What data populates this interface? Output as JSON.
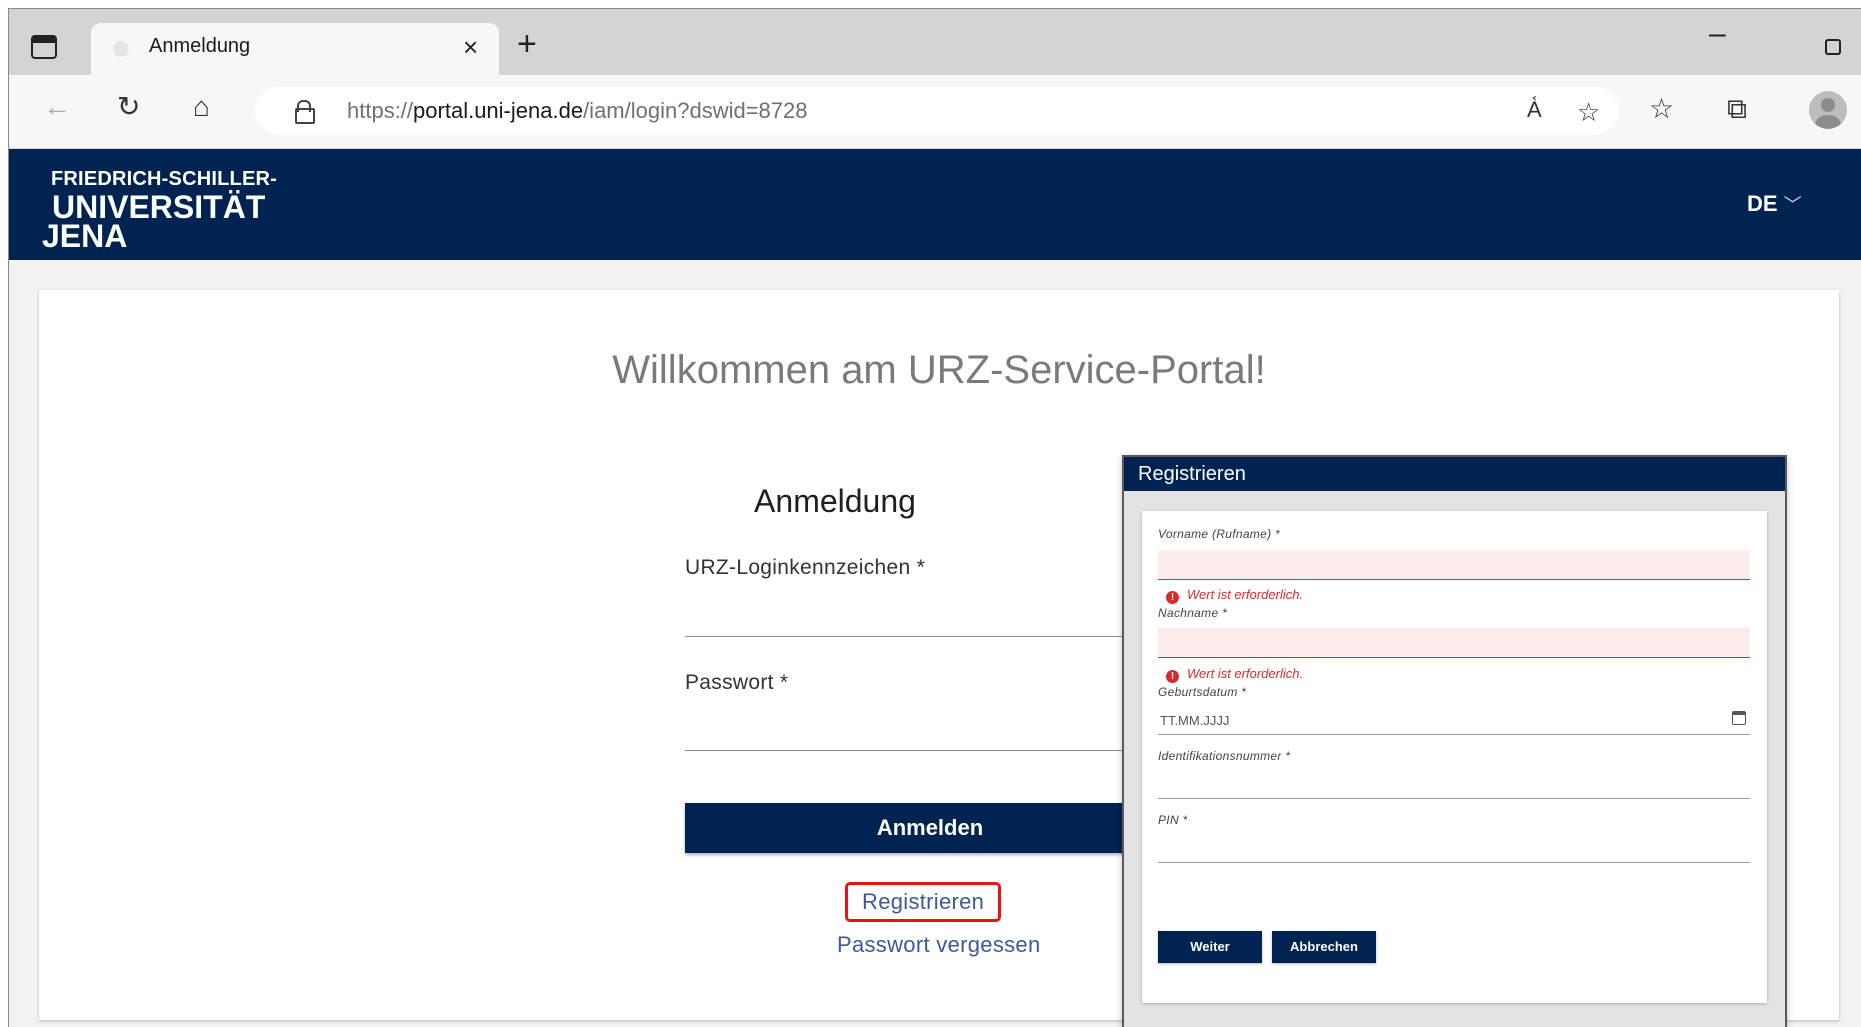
{
  "browser": {
    "tab_title": "Anmeldung",
    "tab_close": "×",
    "new_tab": "+",
    "url_prefix": "https://",
    "url_host": "portal.uni-jena.de",
    "url_path": "/iam/login?dswid=8728"
  },
  "header": {
    "logo_line1": "FRIEDRICH-SCHILLER-",
    "logo_line2": "UNIVERSITÄT",
    "logo_line3": "JENA",
    "language": "DE"
  },
  "login": {
    "welcome": "Willkommen am URZ-Service-Portal!",
    "title": "Anmeldung",
    "username_label": "URZ-Loginkennzeichen *",
    "password_label": "Passwort *",
    "submit": "Anmelden",
    "register_link": "Registrieren",
    "forgot_link": "Passwort vergessen"
  },
  "dialog": {
    "title": "Registrieren",
    "firstname_label": "Vorname (Rufname) *",
    "firstname_error": "Wert ist erforderlich.",
    "lastname_label": "Nachname *",
    "lastname_error": "Wert ist erforderlich.",
    "birthdate_label": "Geburtsdatum *",
    "birthdate_placeholder": "TT.MM.JJJJ",
    "id_label": "Identifikationsnummer *",
    "pin_label": "PIN *",
    "next_button": "Weiter",
    "cancel_button": "Abbrechen"
  }
}
